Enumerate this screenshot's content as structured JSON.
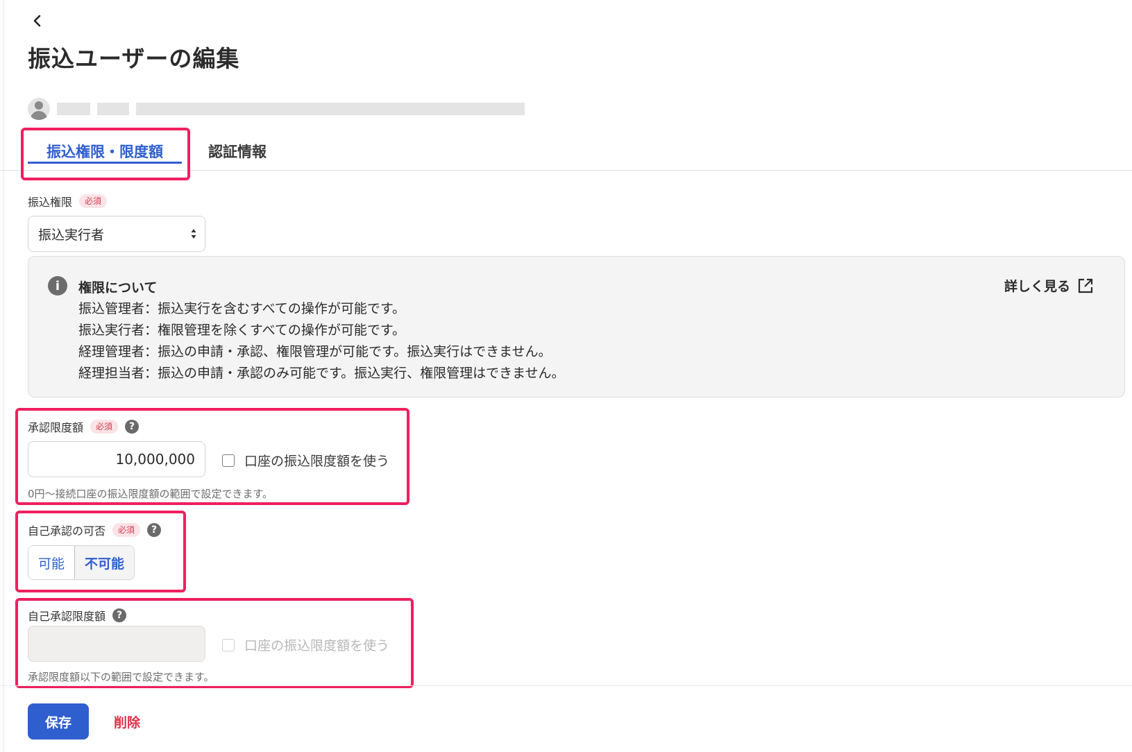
{
  "header": {
    "back_icon": "chevron-left-icon",
    "title": "振込ユーザーの編集"
  },
  "user": {
    "avatar_icon": "user-avatar-icon"
  },
  "tabs": [
    {
      "label": "振込権限・限度額",
      "active": true
    },
    {
      "label": "認証情報",
      "active": false
    }
  ],
  "permission": {
    "label": "振込権限",
    "required_badge": "必須",
    "selected": "振込実行者"
  },
  "info": {
    "icon": "info-icon",
    "title": "権限について",
    "lines": [
      "振込管理者：振込実行を含むすべての操作が可能です。",
      "振込実行者：権限管理を除くすべての操作が可能です。",
      "経理管理者：振込の申請・承認、権限管理が可能です。振込実行はできません。",
      "経理担当者：振込の申請・承認のみ可能です。振込実行、権限管理はできません。"
    ],
    "more_label": "詳しく見る",
    "more_icon": "external-link-icon"
  },
  "approval_limit": {
    "label": "承認限度額",
    "required_badge": "必須",
    "help_icon": "?",
    "value": "10,000,000",
    "checkbox_label": "口座の振込限度額を使う",
    "checked": false,
    "hint": "0円〜接続口座の振込限度額の範囲で設定できます。"
  },
  "self_approval": {
    "label": "自己承認の可否",
    "required_badge": "必須",
    "help_icon": "?",
    "options": [
      "可能",
      "不可能"
    ],
    "selected": "不可能"
  },
  "self_approval_limit": {
    "label": "自己承認限度額",
    "help_icon": "?",
    "value": "",
    "disabled": true,
    "checkbox_label": "口座の振込限度額を使う",
    "checked": false,
    "hint": "承認限度額以下の範囲で設定できます。"
  },
  "footer": {
    "save_label": "保存",
    "delete_label": "削除"
  },
  "colors": {
    "accent": "#2f5fcf",
    "highlight": "#ef1f5f",
    "danger": "#e0304a",
    "required": "#d23a4e"
  }
}
